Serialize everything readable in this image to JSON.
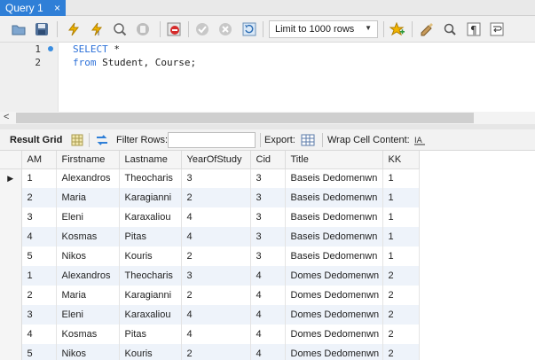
{
  "tab": {
    "title": "Query 1",
    "close": "×"
  },
  "toolbar": {
    "limit_select": "Limit to 1000 rows",
    "icons": [
      "open-folder-icon",
      "save-icon",
      "execute-icon",
      "execute-current-icon",
      "explain-icon",
      "stop-icon",
      "toggle-error-stop-icon",
      "commit-icon",
      "rollback-icon",
      "autocommit-icon",
      "favorite-add-icon",
      "beautify-icon",
      "find-icon",
      "invisible-chars-icon",
      "wrap-icon"
    ]
  },
  "editor": {
    "line_numbers": [
      "1",
      "2"
    ],
    "line1_kw": "SELECT",
    "line1_rest": " *",
    "line2_kw": "from",
    "line2_rest": " Student, Course;"
  },
  "hscroll": {
    "arrow": "<"
  },
  "result_toolbar": {
    "result_grid": "Result Grid",
    "filter_rows": "Filter Rows:",
    "export": "Export:",
    "wrap_cell": "Wrap Cell Content:"
  },
  "grid": {
    "columns": [
      "AM",
      "Firstname",
      "Lastname",
      "YearOfStudy",
      "Cid",
      "Title",
      "KK"
    ],
    "rows": [
      [
        "1",
        "Alexandros",
        "Theocharis",
        "3",
        "3",
        "Baseis Dedomenwn",
        "1"
      ],
      [
        "2",
        "Maria",
        "Karagianni",
        "2",
        "3",
        "Baseis Dedomenwn",
        "1"
      ],
      [
        "3",
        "Eleni",
        "Karaxaliou",
        "4",
        "3",
        "Baseis Dedomenwn",
        "1"
      ],
      [
        "4",
        "Kosmas",
        "Pitas",
        "4",
        "3",
        "Baseis Dedomenwn",
        "1"
      ],
      [
        "5",
        "Nikos",
        "Kouris",
        "2",
        "3",
        "Baseis Dedomenwn",
        "1"
      ],
      [
        "1",
        "Alexandros",
        "Theocharis",
        "3",
        "4",
        "Domes Dedomenwn",
        "2"
      ],
      [
        "2",
        "Maria",
        "Karagianni",
        "2",
        "4",
        "Domes Dedomenwn",
        "2"
      ],
      [
        "3",
        "Eleni",
        "Karaxaliou",
        "4",
        "4",
        "Domes Dedomenwn",
        "2"
      ],
      [
        "4",
        "Kosmas",
        "Pitas",
        "4",
        "4",
        "Domes Dedomenwn",
        "2"
      ],
      [
        "5",
        "Nikos",
        "Kouris",
        "2",
        "4",
        "Domes Dedomenwn",
        "2"
      ]
    ]
  },
  "colors": {
    "tab_active": "#2f7fd7",
    "keyword": "#2a6fd8",
    "row_alt": "#eef3fa"
  }
}
